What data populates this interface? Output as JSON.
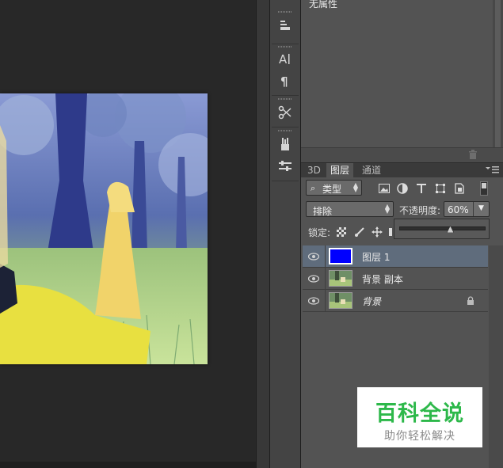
{
  "properties_panel": {
    "title": "无属性"
  },
  "layers_panel": {
    "tabs": [
      {
        "label": "3D",
        "active": false
      },
      {
        "label": "图层",
        "active": true
      },
      {
        "label": "通道",
        "active": false
      }
    ],
    "filter": {
      "label": "类型"
    },
    "filter_icons": [
      "image-filter-icon",
      "adjustment-filter-icon",
      "type-filter-icon",
      "shape-filter-icon",
      "smart-object-filter-icon"
    ],
    "blend_mode": "排除",
    "opacity": {
      "label": "不透明度:",
      "value": "60%"
    },
    "opacity_slider_value": 0.6,
    "lock": {
      "label": "锁定:"
    },
    "layers": [
      {
        "name": "图层 1",
        "fill_color": "#0000ff",
        "selected": true
      },
      {
        "name": "背景 副本",
        "selected": false
      },
      {
        "name": "背景",
        "selected": false,
        "locked": true
      }
    ]
  },
  "watermark": {
    "title": "百科全说",
    "subtitle": "助你轻松解决"
  },
  "colors": {
    "layer_fill": "#0000ff",
    "selection": "#5f6c7c",
    "watermark_green": "#2db84a"
  }
}
